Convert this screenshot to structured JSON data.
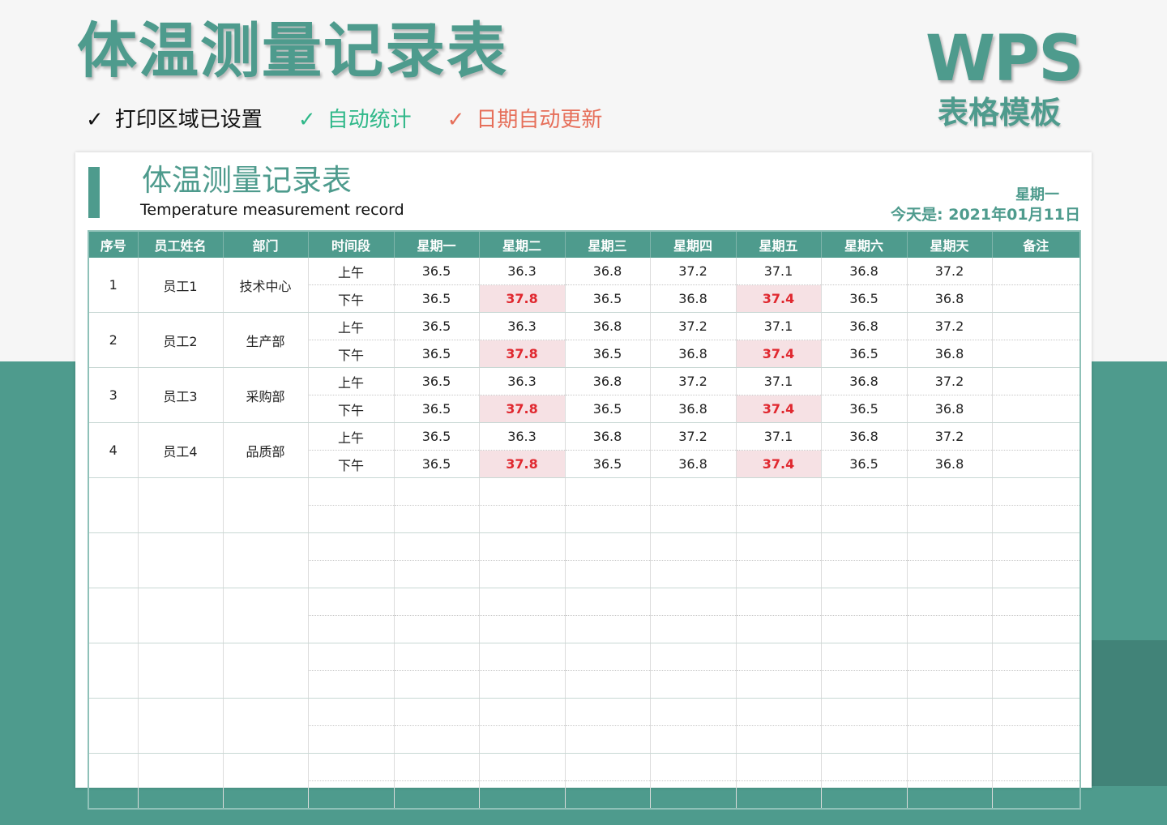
{
  "header": {
    "title": "体温测量记录表",
    "features": [
      {
        "check": "✓",
        "text": "打印区域已设置"
      },
      {
        "check": "✓",
        "text": "自动统计"
      },
      {
        "check": "✓",
        "text": "日期自动更新"
      }
    ],
    "logo": "WPS",
    "logo_sub": "表格模板"
  },
  "sheet": {
    "title": "体温测量记录表",
    "subtitle": "Temperature measurement record",
    "weekday": "星期一",
    "today": "今天是: 2021年01月11日"
  },
  "table": {
    "columns": [
      "序号",
      "员工姓名",
      "部门",
      "时间段",
      "星期一",
      "星期二",
      "星期三",
      "星期四",
      "星期五",
      "星期六",
      "星期天",
      "备注"
    ],
    "employees": [
      {
        "no": "1",
        "name": "员工1",
        "dept": "技术中心",
        "am": {
          "label": "上午",
          "vals": [
            "36.5",
            "36.3",
            "36.8",
            "37.2",
            "37.1",
            "36.8",
            "37.2"
          ]
        },
        "pm": {
          "label": "下午",
          "vals": [
            "36.5",
            "37.8",
            "36.5",
            "36.8",
            "37.4",
            "36.5",
            "36.8"
          ]
        }
      },
      {
        "no": "2",
        "name": "员工2",
        "dept": "生产部",
        "am": {
          "label": "上午",
          "vals": [
            "36.5",
            "36.3",
            "36.8",
            "37.2",
            "37.1",
            "36.8",
            "37.2"
          ]
        },
        "pm": {
          "label": "下午",
          "vals": [
            "36.5",
            "37.8",
            "36.5",
            "36.8",
            "37.4",
            "36.5",
            "36.8"
          ]
        }
      },
      {
        "no": "3",
        "name": "员工3",
        "dept": "采购部",
        "am": {
          "label": "上午",
          "vals": [
            "36.5",
            "36.3",
            "36.8",
            "37.2",
            "37.1",
            "36.8",
            "37.2"
          ]
        },
        "pm": {
          "label": "下午",
          "vals": [
            "36.5",
            "37.8",
            "36.5",
            "36.8",
            "37.4",
            "36.5",
            "36.8"
          ]
        }
      },
      {
        "no": "4",
        "name": "员工4",
        "dept": "品质部",
        "am": {
          "label": "上午",
          "vals": [
            "36.5",
            "36.3",
            "36.8",
            "37.2",
            "37.1",
            "36.8",
            "37.2"
          ]
        },
        "pm": {
          "label": "下午",
          "vals": [
            "36.5",
            "37.8",
            "36.5",
            "36.8",
            "37.4",
            "36.5",
            "36.8"
          ]
        }
      }
    ],
    "empty_groups": 6,
    "fever_threshold": 37.3,
    "fever_color": "#e0282f",
    "fever_bg": "#f6e1e4"
  },
  "colors": {
    "accent": "#4e9b8d",
    "check_green": "#2fb889",
    "check_orange": "#e66f5a"
  }
}
